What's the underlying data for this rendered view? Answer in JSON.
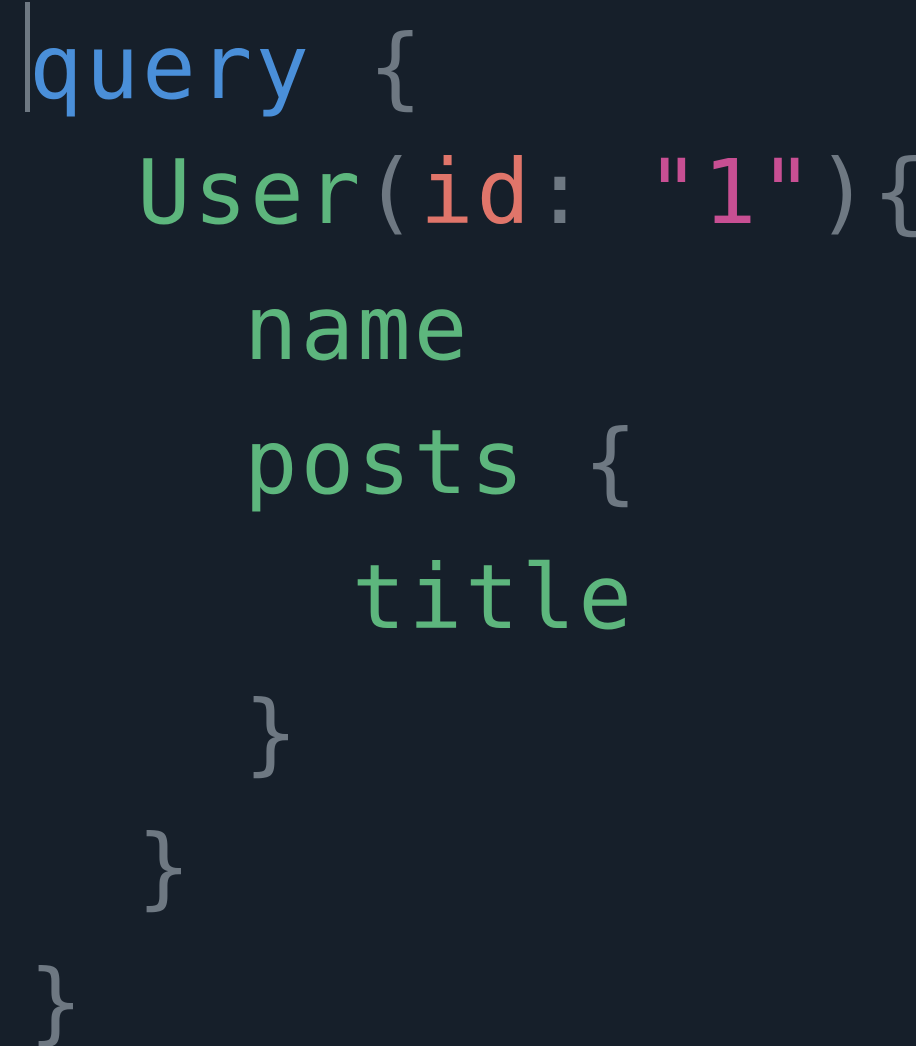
{
  "code": {
    "lines": [
      {
        "keyword": "query",
        "punct_open": " {"
      },
      {
        "field": "User",
        "paren_open": "(",
        "arg_name": "id",
        "colon": ": ",
        "string": "\"1\"",
        "paren_close": ")",
        "brace_open": "{"
      },
      {
        "field": "name"
      },
      {
        "field": "posts",
        "punct_open": " {"
      },
      {
        "field": "title"
      },
      {
        "punct_close": "}"
      },
      {
        "punct_close": "}"
      },
      {
        "punct_close": "}"
      }
    ]
  },
  "colors": {
    "background": "#161f2a",
    "keyword": "#4a8fd9",
    "field": "#5db67d",
    "punctuation": "#6e7882",
    "argument": "#e0756a",
    "string": "#c84f93"
  }
}
